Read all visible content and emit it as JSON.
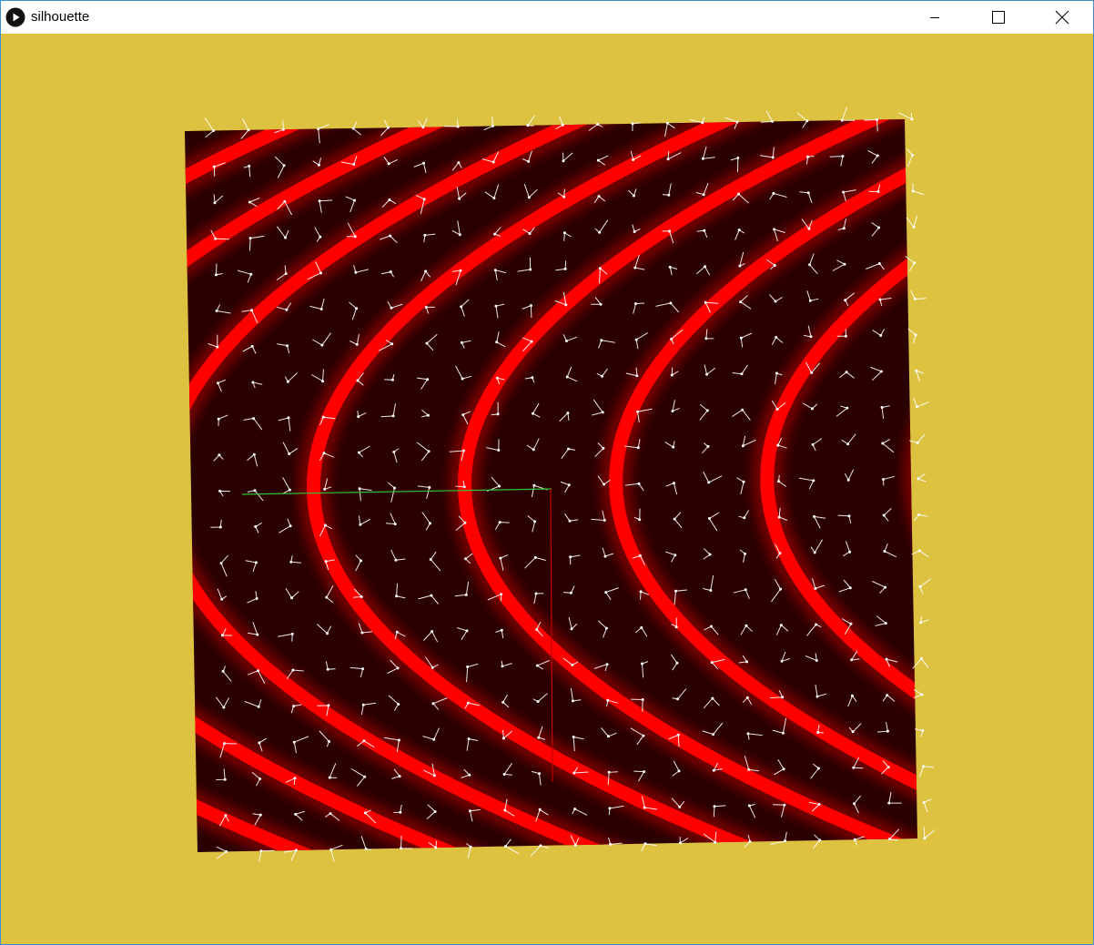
{
  "window": {
    "title": "silhouette",
    "icon": "play-circle-icon",
    "controls": {
      "minimize": "minimize-icon",
      "maximize": "maximize-icon",
      "close": "close-icon"
    }
  },
  "scene": {
    "background_color": "#dcc240",
    "plane_base_color": "#2a0000",
    "band_color": "#ff0000",
    "vector_color": "#ffffff",
    "x_axis_color": "#2ec42e",
    "y_axis_color": "#c00000",
    "vector_grid": {
      "cols": 20,
      "rows": 20
    }
  }
}
